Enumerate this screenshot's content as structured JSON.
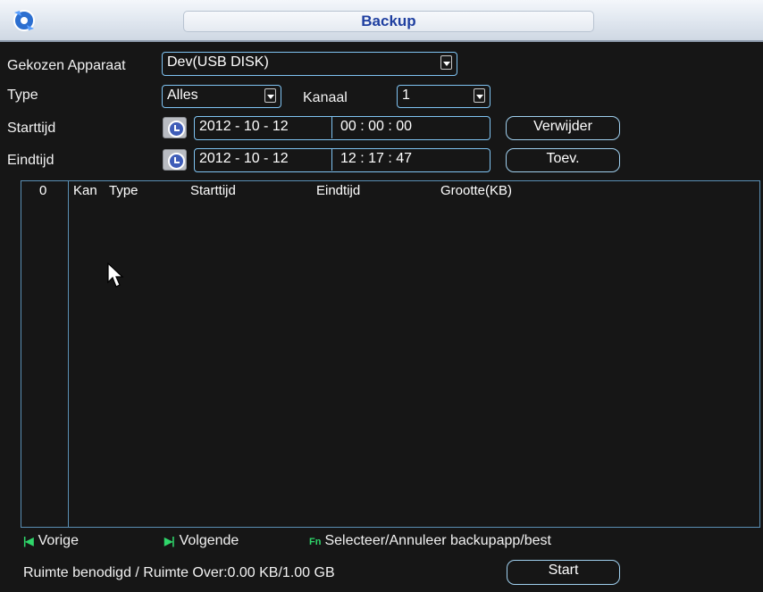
{
  "window": {
    "title": "Backup"
  },
  "form": {
    "device_label": "Gekozen Apparaat",
    "device_value": "Dev(USB DISK)",
    "type_label": "Type",
    "type_value": "Alles",
    "channel_label": "Kanaal",
    "channel_value": "1",
    "start_label": "Starttijd",
    "start_date": "2012  - 10 - 12",
    "start_time": "00 : 00 : 00",
    "end_label": "Eindtijd",
    "end_date": "2012  - 10 - 12",
    "end_time": "12 : 17 : 47",
    "remove_button": "Verwijder",
    "add_button": "Toev."
  },
  "table": {
    "columns": [
      "0",
      "Kan",
      "Type",
      "Starttijd",
      "Eindtijd",
      "Grootte(KB)"
    ],
    "rows": []
  },
  "footer": {
    "prev_label": "Vorige",
    "next_label": "Volgende",
    "fn_icon": "Fn",
    "fn_label": "Selecteer/Annuleer backupapp/best",
    "space_text": "Ruimte benodigd / Ruimte Over:0.00 KB/1.00 GB",
    "start_button": "Start"
  },
  "colors": {
    "accent_border": "#7fc3f2",
    "nav_green": "#2fd66a",
    "title_blue": "#1f3fa0"
  },
  "icons": {
    "app": "backup-app-icon",
    "clock": "clock-icon",
    "prev": "skip-back-icon",
    "next": "skip-forward-icon",
    "cursor": "mouse-pointer-icon"
  }
}
